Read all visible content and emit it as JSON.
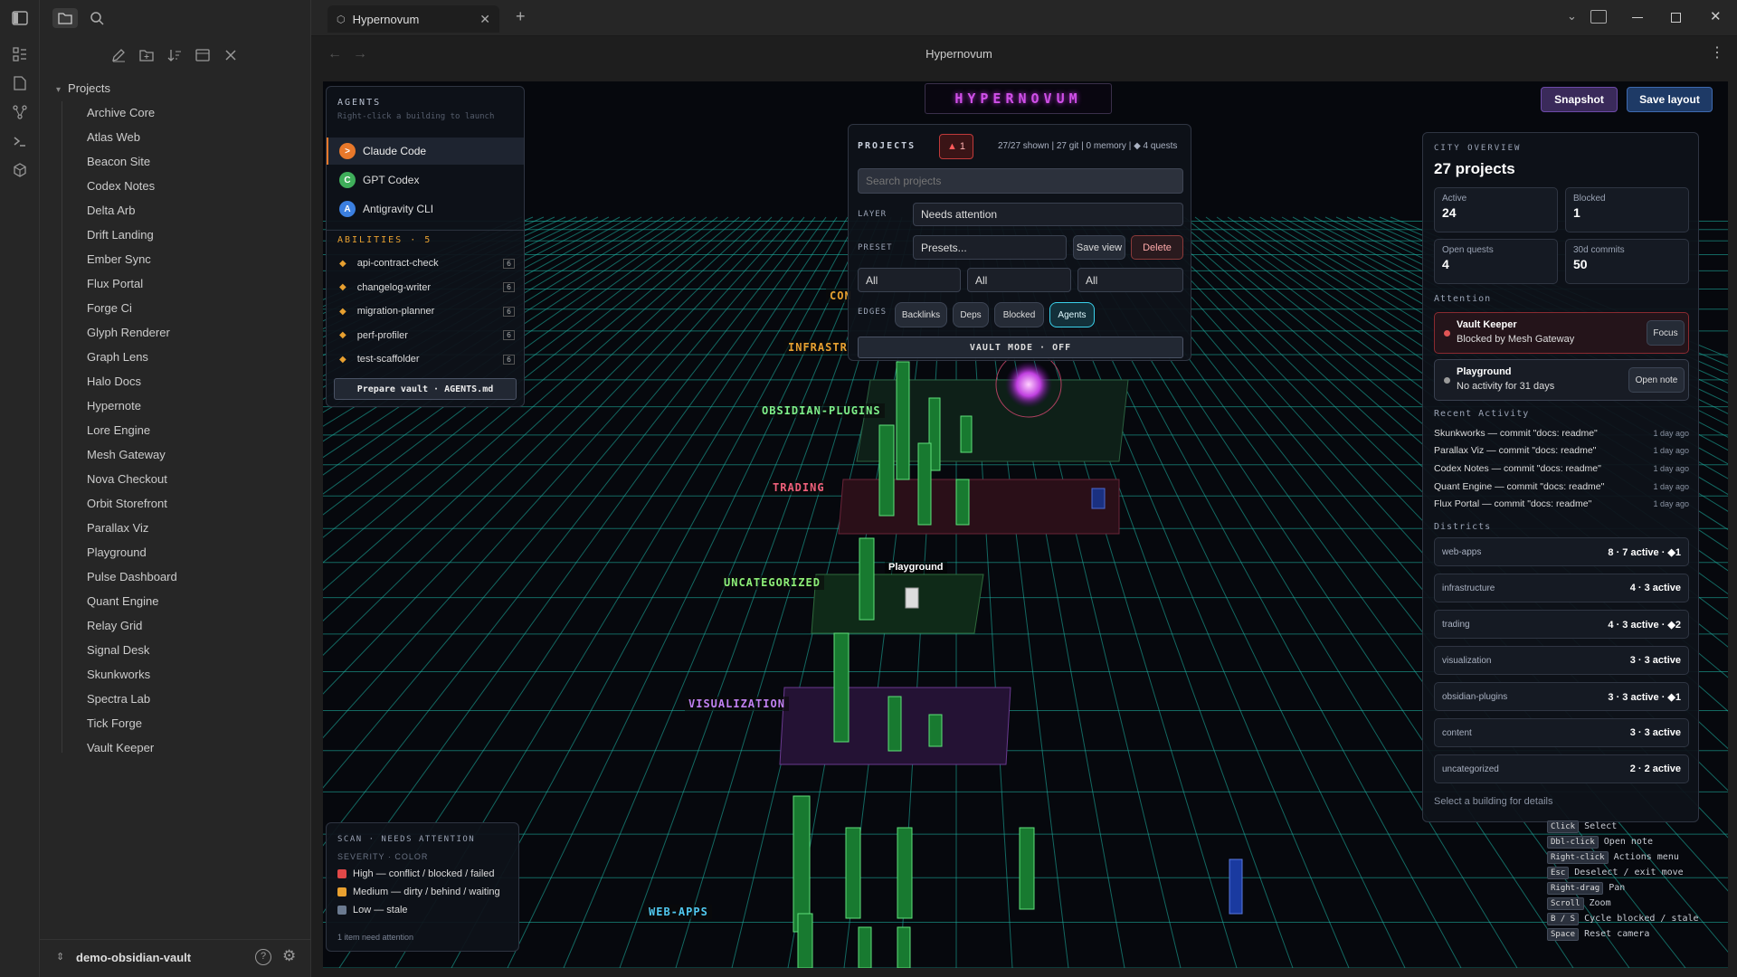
{
  "ribbon": {
    "icons": [
      "sidebar-toggle-icon",
      "folder-icon",
      "search-icon",
      "dashboard-icon",
      "document-icon",
      "graph-icon",
      "terminal-icon",
      "cube-icon"
    ]
  },
  "sidebar": {
    "tree_root": "Projects",
    "items": [
      "Archive Core",
      "Atlas Web",
      "Beacon Site",
      "Codex Notes",
      "Delta Arb",
      "Drift Landing",
      "Ember Sync",
      "Flux Portal",
      "Forge Ci",
      "Glyph Renderer",
      "Graph Lens",
      "Halo Docs",
      "Hypernote",
      "Lore Engine",
      "Mesh Gateway",
      "Nova Checkout",
      "Orbit Storefront",
      "Parallax Viz",
      "Playground",
      "Pulse Dashboard",
      "Quant Engine",
      "Relay Grid",
      "Signal Desk",
      "Skunkworks",
      "Spectra Lab",
      "Tick Forge",
      "Vault Keeper"
    ],
    "vault_name": "demo-obsidian-vault"
  },
  "tab": {
    "title": "Hypernovum"
  },
  "view_title": "Hypernovum",
  "scene": {
    "logo": "HYPERNOVUM",
    "snapshot_label": "Snapshot",
    "save_layout_label": "Save layout",
    "district_labels": {
      "con": "CON",
      "infra": "INFRASTR",
      "plugins": "OBSIDIAN-PLUGINS",
      "trading": "TRADING",
      "uncat": "UNCATEGORIZED",
      "viz": "VISUALIZATION",
      "web": "WEB-APPS"
    },
    "building_tooltip": "Playground"
  },
  "agents": {
    "title": "AGENTS",
    "subtitle": "Right-click a building to launch",
    "list": [
      {
        "badge": ">",
        "name": "Claude Code",
        "color": "#e8782a"
      },
      {
        "badge": "C",
        "name": "GPT Codex",
        "color": "#3fae5a"
      },
      {
        "badge": "A",
        "name": "Antigravity CLI",
        "color": "#3b7fe0"
      }
    ],
    "abilities_title": "ABILITIES · 5",
    "abilities": [
      {
        "name": "api-contract-check",
        "count": "6"
      },
      {
        "name": "changelog-writer",
        "count": "6"
      },
      {
        "name": "migration-planner",
        "count": "6"
      },
      {
        "name": "perf-profiler",
        "count": "6"
      },
      {
        "name": "test-scaffolder",
        "count": "6"
      }
    ],
    "prepare_label": "Prepare vault · AGENTS.md"
  },
  "projects": {
    "title": "PROJECTS",
    "alert_count": "1",
    "summary": "27/27 shown | 27 git | 0 memory | ◆ 4 quests",
    "search_placeholder": "Search projects",
    "layer_label": "LAYER",
    "layer_value": "Needs attention",
    "preset_label": "PRESET",
    "preset_value": "Presets...",
    "save_view": "Save view",
    "delete": "Delete",
    "filters": [
      "All",
      "All",
      "All"
    ],
    "edges_label": "EDGES",
    "edges": [
      "Backlinks",
      "Deps",
      "Blocked",
      "Agents"
    ],
    "vault_mode": "VAULT MODE · OFF"
  },
  "overview": {
    "title": "CITY OVERVIEW",
    "count": "27 projects",
    "stats": [
      {
        "label": "Active",
        "value": "24"
      },
      {
        "label": "Blocked",
        "value": "1"
      },
      {
        "label": "Open quests",
        "value": "4"
      },
      {
        "label": "30d commits",
        "value": "50"
      }
    ],
    "attention_title": "Attention",
    "attention": [
      {
        "name": "Vault Keeper",
        "sub": "Blocked by Mesh Gateway",
        "action": "Focus",
        "dot": "#e05555"
      },
      {
        "name": "Playground",
        "sub": "No activity for 31 days",
        "action": "Open note",
        "dot": "#9a9a9a"
      }
    ],
    "activity_title": "Recent Activity",
    "activity": [
      {
        "text": "Skunkworks — commit \"docs: readme\"",
        "time": "1 day ago"
      },
      {
        "text": "Parallax Viz — commit \"docs: readme\"",
        "time": "1 day ago"
      },
      {
        "text": "Codex Notes — commit \"docs: readme\"",
        "time": "1 day ago"
      },
      {
        "text": "Quant Engine — commit \"docs: readme\"",
        "time": "1 day ago"
      },
      {
        "text": "Flux Portal — commit \"docs: readme\"",
        "time": "1 day ago"
      }
    ],
    "districts_title": "Districts",
    "districts": [
      {
        "name": "web-apps",
        "stat": "8 · 7 active · ◆1"
      },
      {
        "name": "infrastructure",
        "stat": "4 · 3 active"
      },
      {
        "name": "trading",
        "stat": "4 · 3 active · ◆2"
      },
      {
        "name": "visualization",
        "stat": "3 · 3 active"
      },
      {
        "name": "obsidian-plugins",
        "stat": "3 · 3 active · ◆1"
      },
      {
        "name": "content",
        "stat": "3 · 3 active"
      },
      {
        "name": "uncategorized",
        "stat": "2 · 2 active"
      }
    ],
    "footer": "Select a building for details"
  },
  "hints": [
    {
      "key": "Click",
      "desc": "Select"
    },
    {
      "key": "Dbl-click",
      "desc": "Open note"
    },
    {
      "key": "Right-click",
      "desc": "Actions menu"
    },
    {
      "key": "Esc",
      "desc": "Deselect / exit move"
    },
    {
      "key": "Right-drag",
      "desc": "Pan"
    },
    {
      "key": "Scroll",
      "desc": "Zoom"
    },
    {
      "key": "B / S",
      "desc": "Cycle blocked / stale"
    },
    {
      "key": "Space",
      "desc": "Reset camera"
    }
  ],
  "scan": {
    "title": "SCAN · NEEDS ATTENTION",
    "subtitle": "SEVERITY · COLOR",
    "items": [
      {
        "text": "High — conflict / blocked / failed",
        "color": "#e04848"
      },
      {
        "text": "Medium — dirty / behind / waiting",
        "color": "#e8a030"
      },
      {
        "text": "Low — stale",
        "color": "#6b7a90"
      }
    ],
    "footer": "1 item need attention"
  }
}
